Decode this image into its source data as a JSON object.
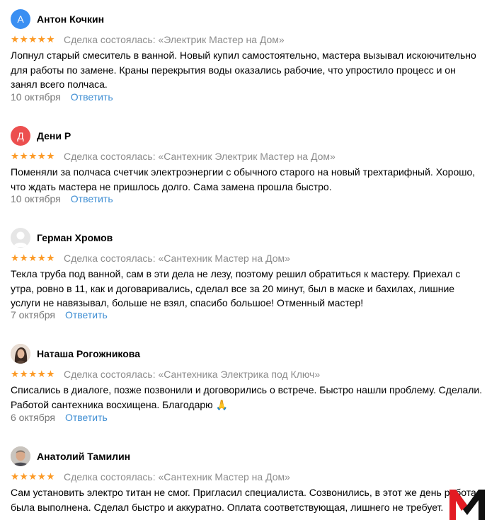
{
  "colors": {
    "star": "#fc9a26",
    "link": "#3f8ed3",
    "muted": "#8c8c8c",
    "avatar_anton": "#3a8ff2",
    "avatar_deni": "#ec4f4f",
    "logo_red": "#e31b23",
    "logo_black": "#111111"
  },
  "stars_glyph": "★★★★★",
  "deal_prefix": "Сделка состоялась:",
  "reply_label": "Ответить",
  "reviews": [
    {
      "initial": "А",
      "author": "Антон Кочкин",
      "rating": 5,
      "deal": "Сделка состоялась: «Электрик Мастер на Дом»",
      "text": "Лопнул старый смеситель в ванной. Новый купил самостоятельно, мастера вызывал искоючительно для работы по замене. Краны перекрытия воды оказались рабочие, что упростило процесс и он занял всего полчаса.",
      "date": "10 октября",
      "reply": "Ответить"
    },
    {
      "initial": "Д",
      "author": "Дени Р",
      "rating": 5,
      "deal": "Сделка состоялась: «Сантехник Электрик Мастер на Дом»",
      "text": "Поменяли за полчаса счетчик электроэнергии с обычного старого на новый трехтарифный. Хорошо, что ждать мастера не пришлось долго. Сама замена прошла быстро.",
      "date": "10 октября",
      "reply": "Ответить"
    },
    {
      "initial": "",
      "author": "Герман Хромов",
      "rating": 5,
      "deal": "Сделка состоялась: «Сантехник Мастер на Дом»",
      "text": "Текла труба под ванной, сам в эти дела не лезу, поэтому решил обратиться к мастеру. Приехал с утра, ровно в 11, как и договаривались, сделал все за 20 минут, был в маске и бахилах, лишние услуги не навязывал, больше не взял, спасибо большое! Отменный мастер!",
      "date": "7 октября",
      "reply": "Ответить"
    },
    {
      "initial": "",
      "author": "Наташа Рогожникова",
      "rating": 5,
      "deal": "Сделка состоялась: «Сантехника Электрика под Ключ»",
      "text": "Списались в диалоге, позже позвонили и договорились о встрече. Быстро нашли проблему. Сделали. Работой сантехника восхищена. Благодарю 🙏",
      "date": "6 октября",
      "reply": "Ответить"
    },
    {
      "initial": "",
      "author": "Анатолий Тамилин",
      "rating": 5,
      "deal": "Сделка состоялась: «Сантехник Мастер на Дом»",
      "text": "Сам установить электро титан не смог. Пригласил специалиста. Созвонились, в этот же день работа была выполнена. Сделал быстро и аккуратно. Оплата соответствующая, лишнего не требует.",
      "date": "",
      "reply": ""
    }
  ]
}
